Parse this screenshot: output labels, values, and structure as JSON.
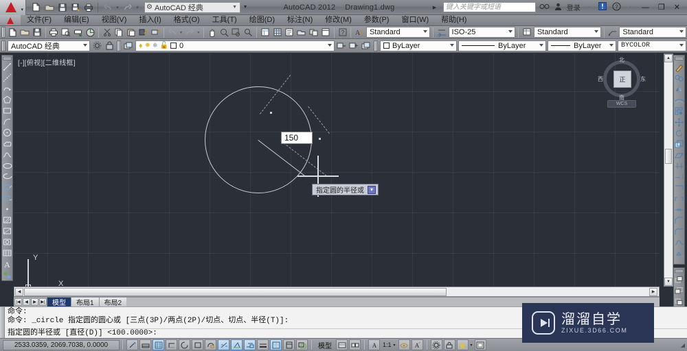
{
  "titlebar": {
    "workspace": "AutoCAD 经典",
    "app_title": "AutoCAD 2012",
    "file_title": "Drawing1.dwg",
    "search_placeholder": "键入关键字或短语",
    "signin": "登录",
    "quick_icons": [
      "new-file-icon",
      "open-folder-icon",
      "save-icon",
      "save-as-icon",
      "plot-icon",
      "undo-icon",
      "redo-icon"
    ],
    "window_buttons": [
      "minimize",
      "maximize",
      "close"
    ]
  },
  "menubar": {
    "items": [
      {
        "label": "文件(F)"
      },
      {
        "label": "编辑(E)"
      },
      {
        "label": "视图(V)"
      },
      {
        "label": "插入(I)"
      },
      {
        "label": "格式(O)"
      },
      {
        "label": "工具(T)"
      },
      {
        "label": "绘图(D)"
      },
      {
        "label": "标注(N)"
      },
      {
        "label": "修改(M)"
      },
      {
        "label": "参数(P)"
      },
      {
        "label": "窗口(W)"
      },
      {
        "label": "帮助(H)"
      }
    ]
  },
  "toolbar_row1": {
    "text_style": "Standard",
    "dim_style": "ISO-25",
    "table_style": "Standard",
    "mleader_style": "Standard"
  },
  "toolbar_row2": {
    "workspace": "AutoCAD 经典",
    "layer": "0",
    "color": "ByLayer",
    "linetype": "ByLayer",
    "lineweight": "ByLayer",
    "plotstyle": "BYCOLOR"
  },
  "canvas": {
    "viewport_label": "[-][俯视][二维线框]",
    "dynamic_input_value": "150",
    "dynamic_tooltip": "指定圆的半径或",
    "ucs_x": "X",
    "ucs_y": "Y",
    "viewcube": {
      "north": "北",
      "south": "南",
      "east": "东",
      "west": "西",
      "face": "正",
      "wcs": "WCS"
    }
  },
  "tabs": {
    "items": [
      {
        "label": "模型",
        "active": true
      },
      {
        "label": "布局1",
        "active": false
      },
      {
        "label": "布局2",
        "active": false
      }
    ]
  },
  "command_line": {
    "lines": [
      "命令:",
      "命令: _circle 指定圆的圆心或 [三点(3P)/两点(2P)/切点、切点、半径(T)]:"
    ],
    "prompt": "指定圆的半径或 [直径(D)] <100.0000>:"
  },
  "statusbar": {
    "coordinates": "2533.0359,  2069.7038,  0.0000",
    "model_label": "模型",
    "scale": "1:1",
    "toggles": [
      {
        "name": "infer-constraints",
        "on": false
      },
      {
        "name": "snap-mode",
        "on": false
      },
      {
        "name": "grid-display",
        "on": true
      },
      {
        "name": "ortho-mode",
        "on": false
      },
      {
        "name": "polar-tracking",
        "on": false
      },
      {
        "name": "object-snap",
        "on": false
      },
      {
        "name": "3d-object-snap",
        "on": false
      },
      {
        "name": "object-snap-tracking",
        "on": true
      },
      {
        "name": "allow-ucs",
        "on": true
      },
      {
        "name": "dynamic-input",
        "on": true
      },
      {
        "name": "show-lineweight",
        "on": false
      },
      {
        "name": "transparency",
        "on": true
      },
      {
        "name": "quick-properties",
        "on": false
      },
      {
        "name": "selection-cycling",
        "on": false
      }
    ]
  },
  "watermark": {
    "title": "溜溜自学",
    "url": "ZIXUE.3D66.COM"
  },
  "colors": {
    "canvas_bg": "#2b3038",
    "geometry": "#c9cdd2",
    "accent_tab": "#1d3a6b",
    "watermark_bg": "#2b3556"
  }
}
